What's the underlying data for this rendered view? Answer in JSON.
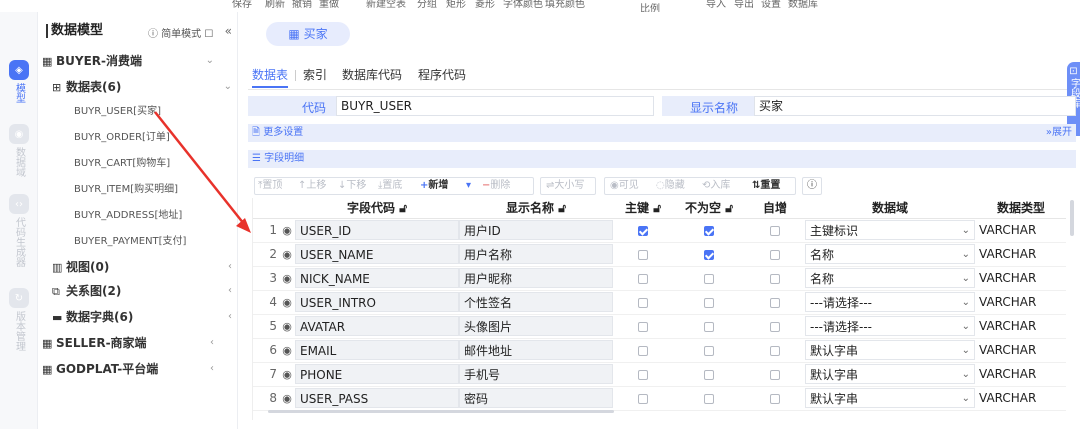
{
  "topbar": {
    "items": [
      "保存",
      "刷新",
      "撤销",
      "重做",
      "新建空表",
      "分组",
      "矩形",
      "菱形",
      "字体颜色",
      "填充颜色",
      "比例",
      "导入",
      "导出",
      "设置",
      "数据库"
    ]
  },
  "rail": {
    "items": [
      {
        "label": "模型",
        "icon": "cube-icon",
        "active": true
      },
      {
        "label": "数据域",
        "icon": "database-icon",
        "active": false
      },
      {
        "label": "代码生成器",
        "icon": "code-icon",
        "active": false
      },
      {
        "label": "版本管理",
        "icon": "history-icon",
        "active": false
      }
    ]
  },
  "tree": {
    "title": "数据模型",
    "mode_label": "简单模式",
    "collapse_label": "«",
    "groups": [
      {
        "label": "BUYER-消费端",
        "chevron": "⌄"
      },
      {
        "label": "数据表(6)",
        "chevron": "⌄"
      },
      {
        "label": "视图(0)",
        "chevron": "‹"
      },
      {
        "label": "关系图(2)",
        "chevron": "‹"
      },
      {
        "label": "数据字典(6)",
        "chevron": "‹"
      },
      {
        "label": "SELLER-商家端",
        "chevron": "‹"
      },
      {
        "label": "GODPLAT-平台端",
        "chevron": "‹"
      }
    ],
    "tables": [
      "BUYR_USER[买家]",
      "BUYR_ORDER[订单]",
      "BUYR_CART[购物车]",
      "BUYR_ITEM[购买明细]",
      "BUYR_ADDRESS[地址]",
      "BUYER_PAYMENT[支付]"
    ]
  },
  "main": {
    "entity": "买家",
    "tabs": [
      "数据表",
      "索引",
      "数据库代码",
      "程序代码"
    ],
    "side_tag": "字段库",
    "code_label": "代码",
    "code_value": "BUYR_USER",
    "display_label": "显示名称",
    "display_value": "买家",
    "more_settings": "更多设置",
    "expand": "展开",
    "field_detail": "字段明细"
  },
  "toolbar": {
    "top": "置顶",
    "up": "上移",
    "down": "下移",
    "bottom": "置底",
    "add": "新增",
    "delete": "删除",
    "case": "大小写",
    "visible": "可见",
    "hidden": "隐藏",
    "warehouse": "入库",
    "reset": "重置"
  },
  "grid": {
    "headers": {
      "code": "字段代码",
      "name": "显示名称",
      "pk": "主键",
      "notnull": "不为空",
      "auto": "自增",
      "domain": "数据域",
      "type": "数据类型"
    },
    "rows": [
      {
        "num": "1",
        "code": "USER_ID",
        "name": "用户ID",
        "pk": true,
        "notnull": true,
        "auto": false,
        "domain": "主键标识",
        "type": "VARCHAR"
      },
      {
        "num": "2",
        "code": "USER_NAME",
        "name": "用户名称",
        "pk": false,
        "notnull": true,
        "auto": false,
        "domain": "名称",
        "type": "VARCHAR"
      },
      {
        "num": "3",
        "code": "NICK_NAME",
        "name": "用户昵称",
        "pk": false,
        "notnull": false,
        "auto": false,
        "domain": "名称",
        "type": "VARCHAR"
      },
      {
        "num": "4",
        "code": "USER_INTRO",
        "name": "个性签名",
        "pk": false,
        "notnull": false,
        "auto": false,
        "domain": "---请选择---",
        "type": "VARCHAR"
      },
      {
        "num": "5",
        "code": "AVATAR",
        "name": "头像图片",
        "pk": false,
        "notnull": false,
        "auto": false,
        "domain": "---请选择---",
        "type": "VARCHAR"
      },
      {
        "num": "6",
        "code": "EMAIL",
        "name": "邮件地址",
        "pk": false,
        "notnull": false,
        "auto": false,
        "domain": "默认字串",
        "type": "VARCHAR"
      },
      {
        "num": "7",
        "code": "PHONE",
        "name": "手机号",
        "pk": false,
        "notnull": false,
        "auto": false,
        "domain": "默认字串",
        "type": "VARCHAR"
      },
      {
        "num": "8",
        "code": "USER_PASS",
        "name": "密码",
        "pk": false,
        "notnull": false,
        "auto": false,
        "domain": "默认字串",
        "type": "VARCHAR"
      }
    ]
  },
  "colors": {
    "accent": "#4a74f5",
    "arrow": "#e8322b"
  }
}
